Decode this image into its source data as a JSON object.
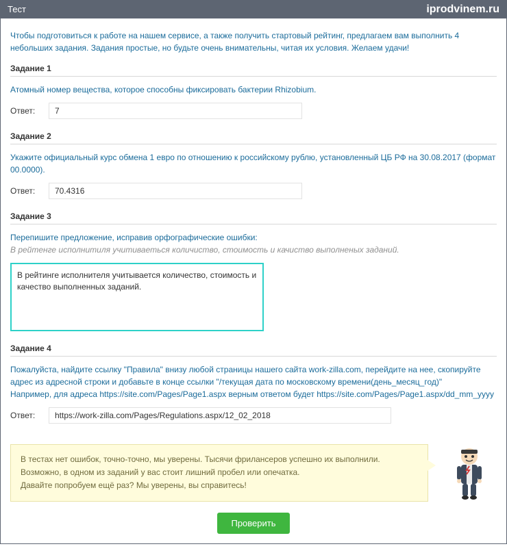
{
  "header": {
    "title": "Тест",
    "brand": "iprodvinem.ru"
  },
  "intro": "Чтобы подготовиться к работе на нашем сервисе, а также получить стартовый рейтинг, предлагаем вам выполнить 4 небольших задания. Задания простые, но будьте очень внимательны, читая их условия. Желаем удачи!",
  "answer_label": "Ответ:",
  "task1": {
    "title": "Задание 1",
    "question": "Атомный номер вещества, которое способны фиксировать бактерии Rhizobium.",
    "value": "7"
  },
  "task2": {
    "title": "Задание 2",
    "question": "Укажите официальный курс обмена 1 евро по отношению к российскому рублю, установленный ЦБ РФ на 30.08.2017 (формат 00.0000).",
    "value": "70.4316"
  },
  "task3": {
    "title": "Задание 3",
    "question_intro": "Перепишите предложение, исправив орфографические ошибки:",
    "question_italic": "В рейтенге исполнитиля учитиваеться  количиство, стоимость и качиство выполненых заданий.",
    "value": "В рейтинге исполнителя учитывается количество, стоимость и качество выполненных заданий."
  },
  "task4": {
    "title": "Задание 4",
    "question_p1": "Пожалуйста, найдите ссылку \"Правила\" внизу любой страницы нашего сайта work-zilla.com, перейдите на нее, скопируйте адрес из адресной строки и добавьте в конце ссылки \"/текущая дата по московскому времени(день_месяц_год)\"",
    "question_p2": "Например, для адреса https://site.com/Pages/Page1.aspx верным ответом будет https://site.com/Pages/Page1.aspx/dd_mm_yyyy",
    "value": "https://work-zilla.com/Pages/Regulations.aspx/12_02_2018"
  },
  "speech": {
    "line1": "В тестах нет ошибок, точно-точно, мы уверены. Тысячи фрилансеров успешно их выполнили.",
    "line2": "Возможно, в одном из заданий у вас стоит лишний пробел или опечатка.",
    "line3": "Давайте попробуем ещё раз? Мы уверены, вы справитесь!"
  },
  "button_check": "Проверить"
}
